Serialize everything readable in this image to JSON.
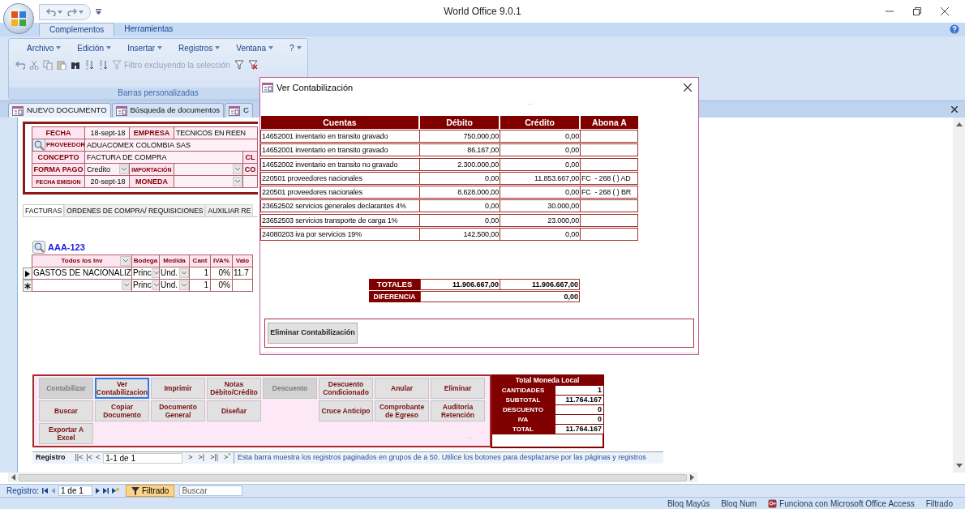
{
  "window": {
    "title": "World Office 9.0.1"
  },
  "ribbon": {
    "tabs": [
      {
        "label": "Complementos",
        "selected": true
      },
      {
        "label": "Herramientas",
        "selected": false
      }
    ],
    "menus": [
      "Archivo",
      "Edición",
      "Insertar",
      "Registros",
      "Ventana",
      "?"
    ],
    "filter_button": {
      "label": "Filtro excluyendo la selección",
      "disabled": true
    },
    "group_label": "Barras personalizadas"
  },
  "doc_tabs": [
    {
      "label": "NUEVO DOCUMENTO",
      "selected": true
    },
    {
      "label": "Búsqueda de documentos",
      "selected": false
    },
    {
      "label": "C",
      "selected": false
    }
  ],
  "header_form": {
    "fecha_label": "FECHA",
    "fecha": "18-sept-18",
    "empresa_label": "EMPRESA",
    "empresa": "TECNICOS EN REEN",
    "proveedor_label": "PROVEEDOR",
    "proveedor": "ADUACOMEX COLOMBIA SAS",
    "concepto_label": "CONCEPTO",
    "concepto": "FACTURA DE COMPRA",
    "cut_label_1": "CL",
    "forma_pago_label": "FORMA PAGO",
    "forma_pago": "Credito",
    "importacion_label": "IMPORTACIÓN",
    "cut_label_2": "CO",
    "fecha_emision_label": "FECHA EMISION",
    "fecha_emision": "20-sept-18",
    "moneda_label": "MONEDA"
  },
  "invoice_tabs": [
    {
      "label": "FACTURAS",
      "selected": true
    },
    {
      "label": "ORDENES DE COMPRA/ REQUISICIONES",
      "selected": false
    },
    {
      "label": "AUXILIAR RE",
      "selected": false
    }
  ],
  "items_grid": {
    "code": "AAA-123",
    "columns": [
      "Todos los Inv",
      "Bodega",
      "Medida",
      "Cant",
      "IVA%",
      "Valo"
    ],
    "rows": [
      {
        "kind": "current",
        "product": "GASTOS DE NACIONALIZ",
        "bodega": "Princ",
        "medida": "Und.",
        "cant": "1",
        "iva": "0%",
        "valor": "11.7"
      },
      {
        "kind": "new",
        "bodega": "Princ",
        "medida": "Und.",
        "cant": "1",
        "iva": "0%"
      }
    ]
  },
  "action_buttons": [
    {
      "kind": "button",
      "label": "Contabilizar",
      "disabled": true,
      "focused": false
    },
    {
      "kind": "button",
      "label": "Ver Contabilizacion",
      "disabled": false,
      "focused": true
    },
    {
      "kind": "button",
      "label": "Imprimir",
      "disabled": false,
      "focused": false
    },
    {
      "kind": "button",
      "label": "Notas Débito/Crédito",
      "disabled": false,
      "focused": false
    },
    {
      "kind": "button",
      "label": "Descuento",
      "disabled": true,
      "focused": false
    },
    {
      "kind": "button",
      "label": "Descuento Condicionado",
      "disabled": false,
      "focused": false
    },
    {
      "kind": "button",
      "label": "Anular",
      "disabled": false,
      "focused": false
    },
    {
      "kind": "button",
      "label": "Eliminar",
      "disabled": false,
      "focused": false
    },
    {
      "kind": "button",
      "label": "Buscar",
      "disabled": false,
      "focused": false
    },
    {
      "kind": "button",
      "label": "Copiar Documento",
      "disabled": false,
      "focused": false
    },
    {
      "kind": "button",
      "label": "Documento General",
      "disabled": false,
      "focused": false
    },
    {
      "kind": "button",
      "label": "Diseñar",
      "disabled": false,
      "focused": false
    },
    {
      "kind": "gap"
    },
    {
      "kind": "button",
      "label": "Cruce Anticipo",
      "disabled": false,
      "focused": false
    },
    {
      "kind": "button",
      "label": "Comprobante de Egreso",
      "disabled": false,
      "focused": false
    },
    {
      "kind": "button",
      "label": "Auditoria Retención",
      "disabled": false,
      "focused": false
    },
    {
      "kind": "button",
      "label": "Exportar A Excel",
      "disabled": false,
      "focused": false
    }
  ],
  "panel_ellipsis": "...",
  "totals": {
    "title": "Total Moneda Local",
    "rows": [
      {
        "label": "CANTIDADES",
        "value": "1"
      },
      {
        "label": "SUBTOTAL",
        "value": "11.764.167"
      },
      {
        "label": "DESCUENTO",
        "value": "0"
      },
      {
        "label": "IVA",
        "value": "0"
      },
      {
        "label": "TOTAL",
        "value": "11.764.167"
      }
    ]
  },
  "record_bar": {
    "label": "Registro",
    "buttons_before": [
      "||<",
      "|<",
      "<"
    ],
    "position": "1-1 de 1",
    "buttons_after": [
      ">",
      ">|",
      ">||",
      ">$^{*}$"
    ],
    "message": "Esta barra muestra los registros paginados en grupos de a 50.  Utilice los botones para desplazarse por las páginas y registros"
  },
  "access_nav": {
    "label": "Registro:",
    "position": "1 de 1",
    "filter": {
      "label": "Filtrado",
      "active": true
    },
    "search": {
      "placeholder": "Buscar"
    }
  },
  "status_bar": {
    "items": [
      {
        "kind": "plain",
        "text": "Bloq Mayús"
      },
      {
        "kind": "plain",
        "text": "Bloq Num"
      },
      {
        "kind": "access",
        "text": "Funciona con Microsoft Office Access"
      },
      {
        "kind": "plain",
        "text": "Filtrado"
      }
    ]
  },
  "dialog": {
    "title": "Ver Contabilización",
    "ellipsis": "...",
    "columns": [
      "Cuentas",
      "Débito",
      "Crédito",
      "Abona A"
    ],
    "rows": [
      {
        "cuenta": "14652001 inventario en transito gravado",
        "debito": "750.000,00",
        "credito": "0,00"
      },
      {
        "cuenta": "14652001 inventario en transito gravado",
        "debito": "86.167,00",
        "credito": "0,00"
      },
      {
        "cuenta": "14652002 inventario en transito no gravado",
        "debito": "2.300.000,00",
        "credito": "0,00"
      },
      {
        "cuenta": "220501 proveedores nacionales",
        "debito": "0,00",
        "credito": "11.853.667,00",
        "abona": "FC  - 268 ( ) AD"
      },
      {
        "cuenta": "220501 proveedores nacionales",
        "debito": "8.628.000,00",
        "credito": "0,00",
        "abona": "FC  - 268 ( ) BR"
      },
      {
        "cuenta": "23652502 servicios generales declarantes 4%",
        "debito": "0,00",
        "credito": "30.000,00"
      },
      {
        "cuenta": "23652503 servicios transporte de carga 1%",
        "debito": "0,00",
        "credito": "23.000,00"
      },
      {
        "cuenta": "24080203 iva por servicios 19%",
        "debito": "142.500,00",
        "credito": "0,00"
      }
    ],
    "totals_label": "TOTALES",
    "total_debito": "11.906.667,00",
    "total_credito": "11.906.667,00",
    "difference_label": "DIFERENCIA",
    "difference": "0,00",
    "button": "Eliminar Contabilización"
  }
}
